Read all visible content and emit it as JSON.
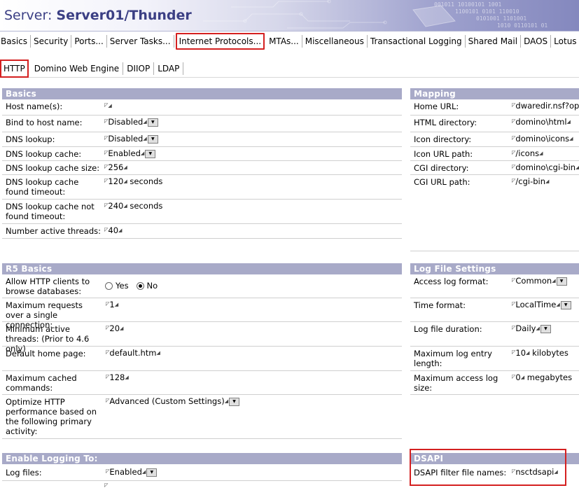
{
  "header": {
    "prefix": "Server:",
    "server": "Server01/Thunder"
  },
  "tabs": [
    "Basics",
    "Security",
    "Ports...",
    "Server Tasks...",
    "Internet Protocols...",
    "MTAs...",
    "Miscellaneous",
    "Transactional Logging",
    "Shared Mail",
    "DAOS",
    "Lotus Traveler"
  ],
  "active_tab": "Internet Protocols...",
  "subtabs": [
    "HTTP",
    "Domino Web Engine",
    "DIIOP",
    "LDAP"
  ],
  "active_subtab": "HTTP",
  "basics": {
    "title": "Basics",
    "rows": [
      {
        "label": "Host name(s):",
        "value": ""
      },
      {
        "label": "Bind to host name:",
        "value": "Disabled",
        "dropdown": true
      },
      {
        "label": "DNS lookup:",
        "value": "Disabled",
        "dropdown": true
      },
      {
        "label": "DNS lookup cache:",
        "value": "Enabled",
        "dropdown": true
      },
      {
        "label": "DNS lookup cache size:",
        "value": "256"
      },
      {
        "label": "DNS lookup cache found timeout:",
        "value": "120",
        "suffix": "seconds"
      },
      {
        "label": "DNS lookup cache not found timeout:",
        "value": "240",
        "suffix": "seconds"
      },
      {
        "label": "Number active threads:",
        "value": "40"
      }
    ]
  },
  "mapping": {
    "title": "Mapping",
    "rows": [
      {
        "label": "Home URL:",
        "value": "dwaredir.nsf?op"
      },
      {
        "label": "HTML directory:",
        "value": "domino\\html"
      },
      {
        "label": "Icon directory:",
        "value": "domino\\icons"
      },
      {
        "label": "Icon URL path:",
        "value": "/icons"
      },
      {
        "label": "CGI directory:",
        "value": "domino\\cgi-bin"
      },
      {
        "label": "CGI URL path:",
        "value": "/cgi-bin"
      }
    ]
  },
  "r5": {
    "title": "R5 Basics",
    "allow_label": "Allow HTTP clients to browse databases:",
    "yes": "Yes",
    "no": "No",
    "selected": "No",
    "rows": [
      {
        "label": "Maximum requests over a single connection:",
        "value": "1"
      },
      {
        "label": "Minimum active threads: (Prior to 4.6 only)",
        "value": "20"
      },
      {
        "label": "Default home page:",
        "value": "default.htm"
      },
      {
        "label": "Maximum cached commands:",
        "value": "128"
      },
      {
        "label": "Optimize HTTP performance based on the following primary activity:",
        "value": "Advanced (Custom Settings)",
        "dropdown": true
      }
    ]
  },
  "logsettings": {
    "title": "Log File Settings",
    "rows": [
      {
        "label": "Access log format:",
        "value": "Common",
        "dropdown": true
      },
      {
        "label": "Time format:",
        "value": "LocalTime",
        "dropdown": true
      },
      {
        "label": "Log file duration:",
        "value": "Daily",
        "dropdown": true
      },
      {
        "label": "Maximum log entry length:",
        "value": "10",
        "suffix": "kilobytes"
      },
      {
        "label": "Maximum access log size:",
        "value": "0",
        "suffix": "megabytes"
      }
    ]
  },
  "logging": {
    "title": "Enable Logging To:",
    "rows": [
      {
        "label": "Log files:",
        "value": "Enabled",
        "dropdown": true
      }
    ]
  },
  "dsapi": {
    "title": "DSAPI",
    "rows": [
      {
        "label": "DSAPI filter file names:",
        "value": "nsctdsapi"
      }
    ]
  },
  "colors": {
    "section_header": "#a8aac8",
    "highlight": "#d42020",
    "title": "#3b3f84"
  }
}
